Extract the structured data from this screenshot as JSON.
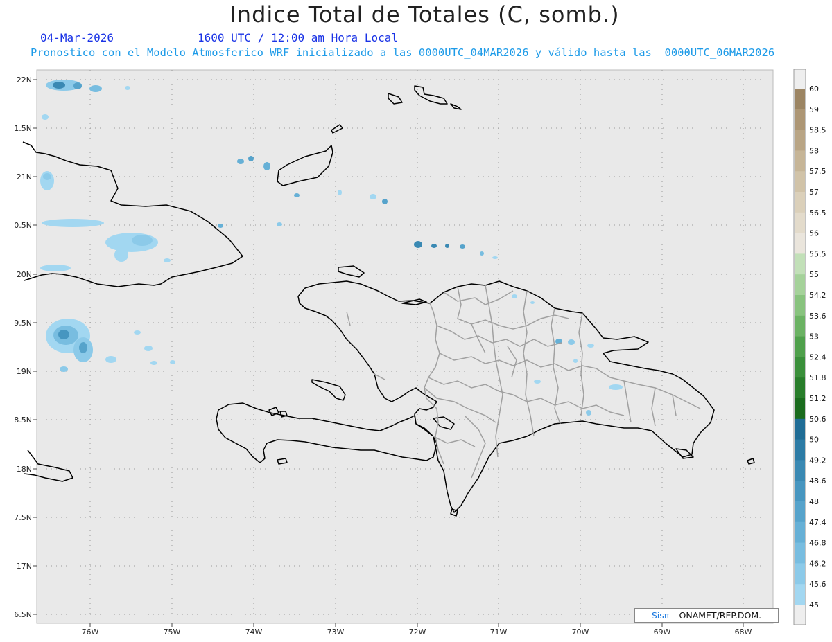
{
  "header": {
    "title": "Indice Total de Totales (C, somb.)",
    "date": "04-Mar-2026",
    "time": "1600 UTC / 12:00 am Hora Local",
    "subtitle": "Pronostico con el Modelo Atmosferico WRF inicializado a las 0000UTC_04MAR2026 y válido hasta las  0000UTC_06MAR2026"
  },
  "map": {
    "lat_labels": [
      "22N",
      "1.5N",
      "21N",
      "0.5N",
      "20N",
      "9.5N",
      "19N",
      "8.5N",
      "18N",
      "7.5N",
      "17N",
      "6.5N"
    ],
    "lon_labels": [
      "76W",
      "75W",
      "74W",
      "73W",
      "72W",
      "71W",
      "70W",
      "69W",
      "68W"
    ],
    "background_color": "#e9e9e9",
    "coast_color": "#000000",
    "province_color": "#a0a0a0"
  },
  "colorbar": {
    "levels": [
      "60",
      "59",
      "58.5",
      "58",
      "57.5",
      "57",
      "56.5",
      "56",
      "55.5",
      "55",
      "54.2",
      "53.6",
      "53",
      "52.4",
      "51.8",
      "51.2",
      "50.6",
      "50",
      "49.2",
      "48.6",
      "48",
      "47.4",
      "46.8",
      "46.2",
      "45.6",
      "45"
    ],
    "colors": [
      "#9c8563",
      "#ad9674",
      "#b9a585",
      "#c6b597",
      "#d1c3a8",
      "#dbd0ba",
      "#e3dbcb",
      "#eae5dc",
      "#c2e0b8",
      "#a5d29a",
      "#88c37e",
      "#6bb263",
      "#4fa04b",
      "#3a8f3a",
      "#287d2a",
      "#1a6b1d",
      "#1f6c95",
      "#2c7ba5",
      "#3a89b3",
      "#4796c0",
      "#56a3cb",
      "#66b0d6",
      "#78bde0",
      "#8ccae9",
      "#a2d7f1"
    ]
  },
  "credit": {
    "sis": "SisT̅̅",
    "sis_text": "Sisπ",
    "rest": "– ONAMET/REP.DOM."
  }
}
